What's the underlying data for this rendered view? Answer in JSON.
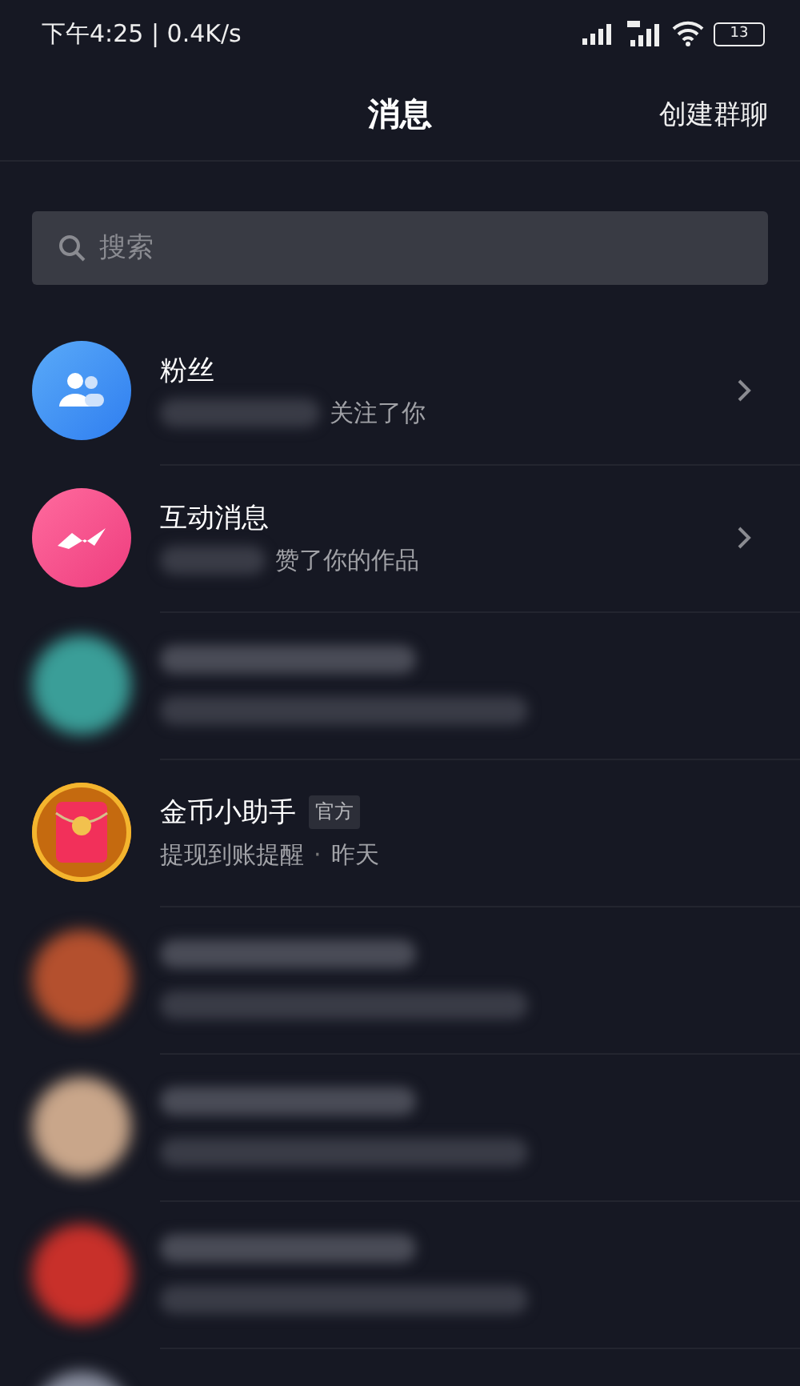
{
  "status_bar": {
    "time": "下午4:25 | 0.4K/s",
    "battery": "13"
  },
  "header": {
    "title": "消息",
    "action": "创建群聊"
  },
  "search": {
    "placeholder": "搜索"
  },
  "conversations": [
    {
      "kind": "fans",
      "title": "粉丝",
      "subtitle": "关注了你"
    },
    {
      "kind": "interactions",
      "title": "互动消息",
      "subtitle": "赞了你的作品"
    },
    {
      "kind": "blurred",
      "color": "#3a9e98"
    },
    {
      "kind": "assistant",
      "title": "金币小助手",
      "badge": "官方",
      "subtitle": "提现到账提醒",
      "separator": "·",
      "time": "昨天"
    },
    {
      "kind": "blurred",
      "color": "#b4502e"
    },
    {
      "kind": "blurred",
      "color": "#c9a68a"
    },
    {
      "kind": "blurred",
      "color": "#c8302a"
    },
    {
      "kind": "blurred",
      "color": "#8a8fa0"
    }
  ]
}
